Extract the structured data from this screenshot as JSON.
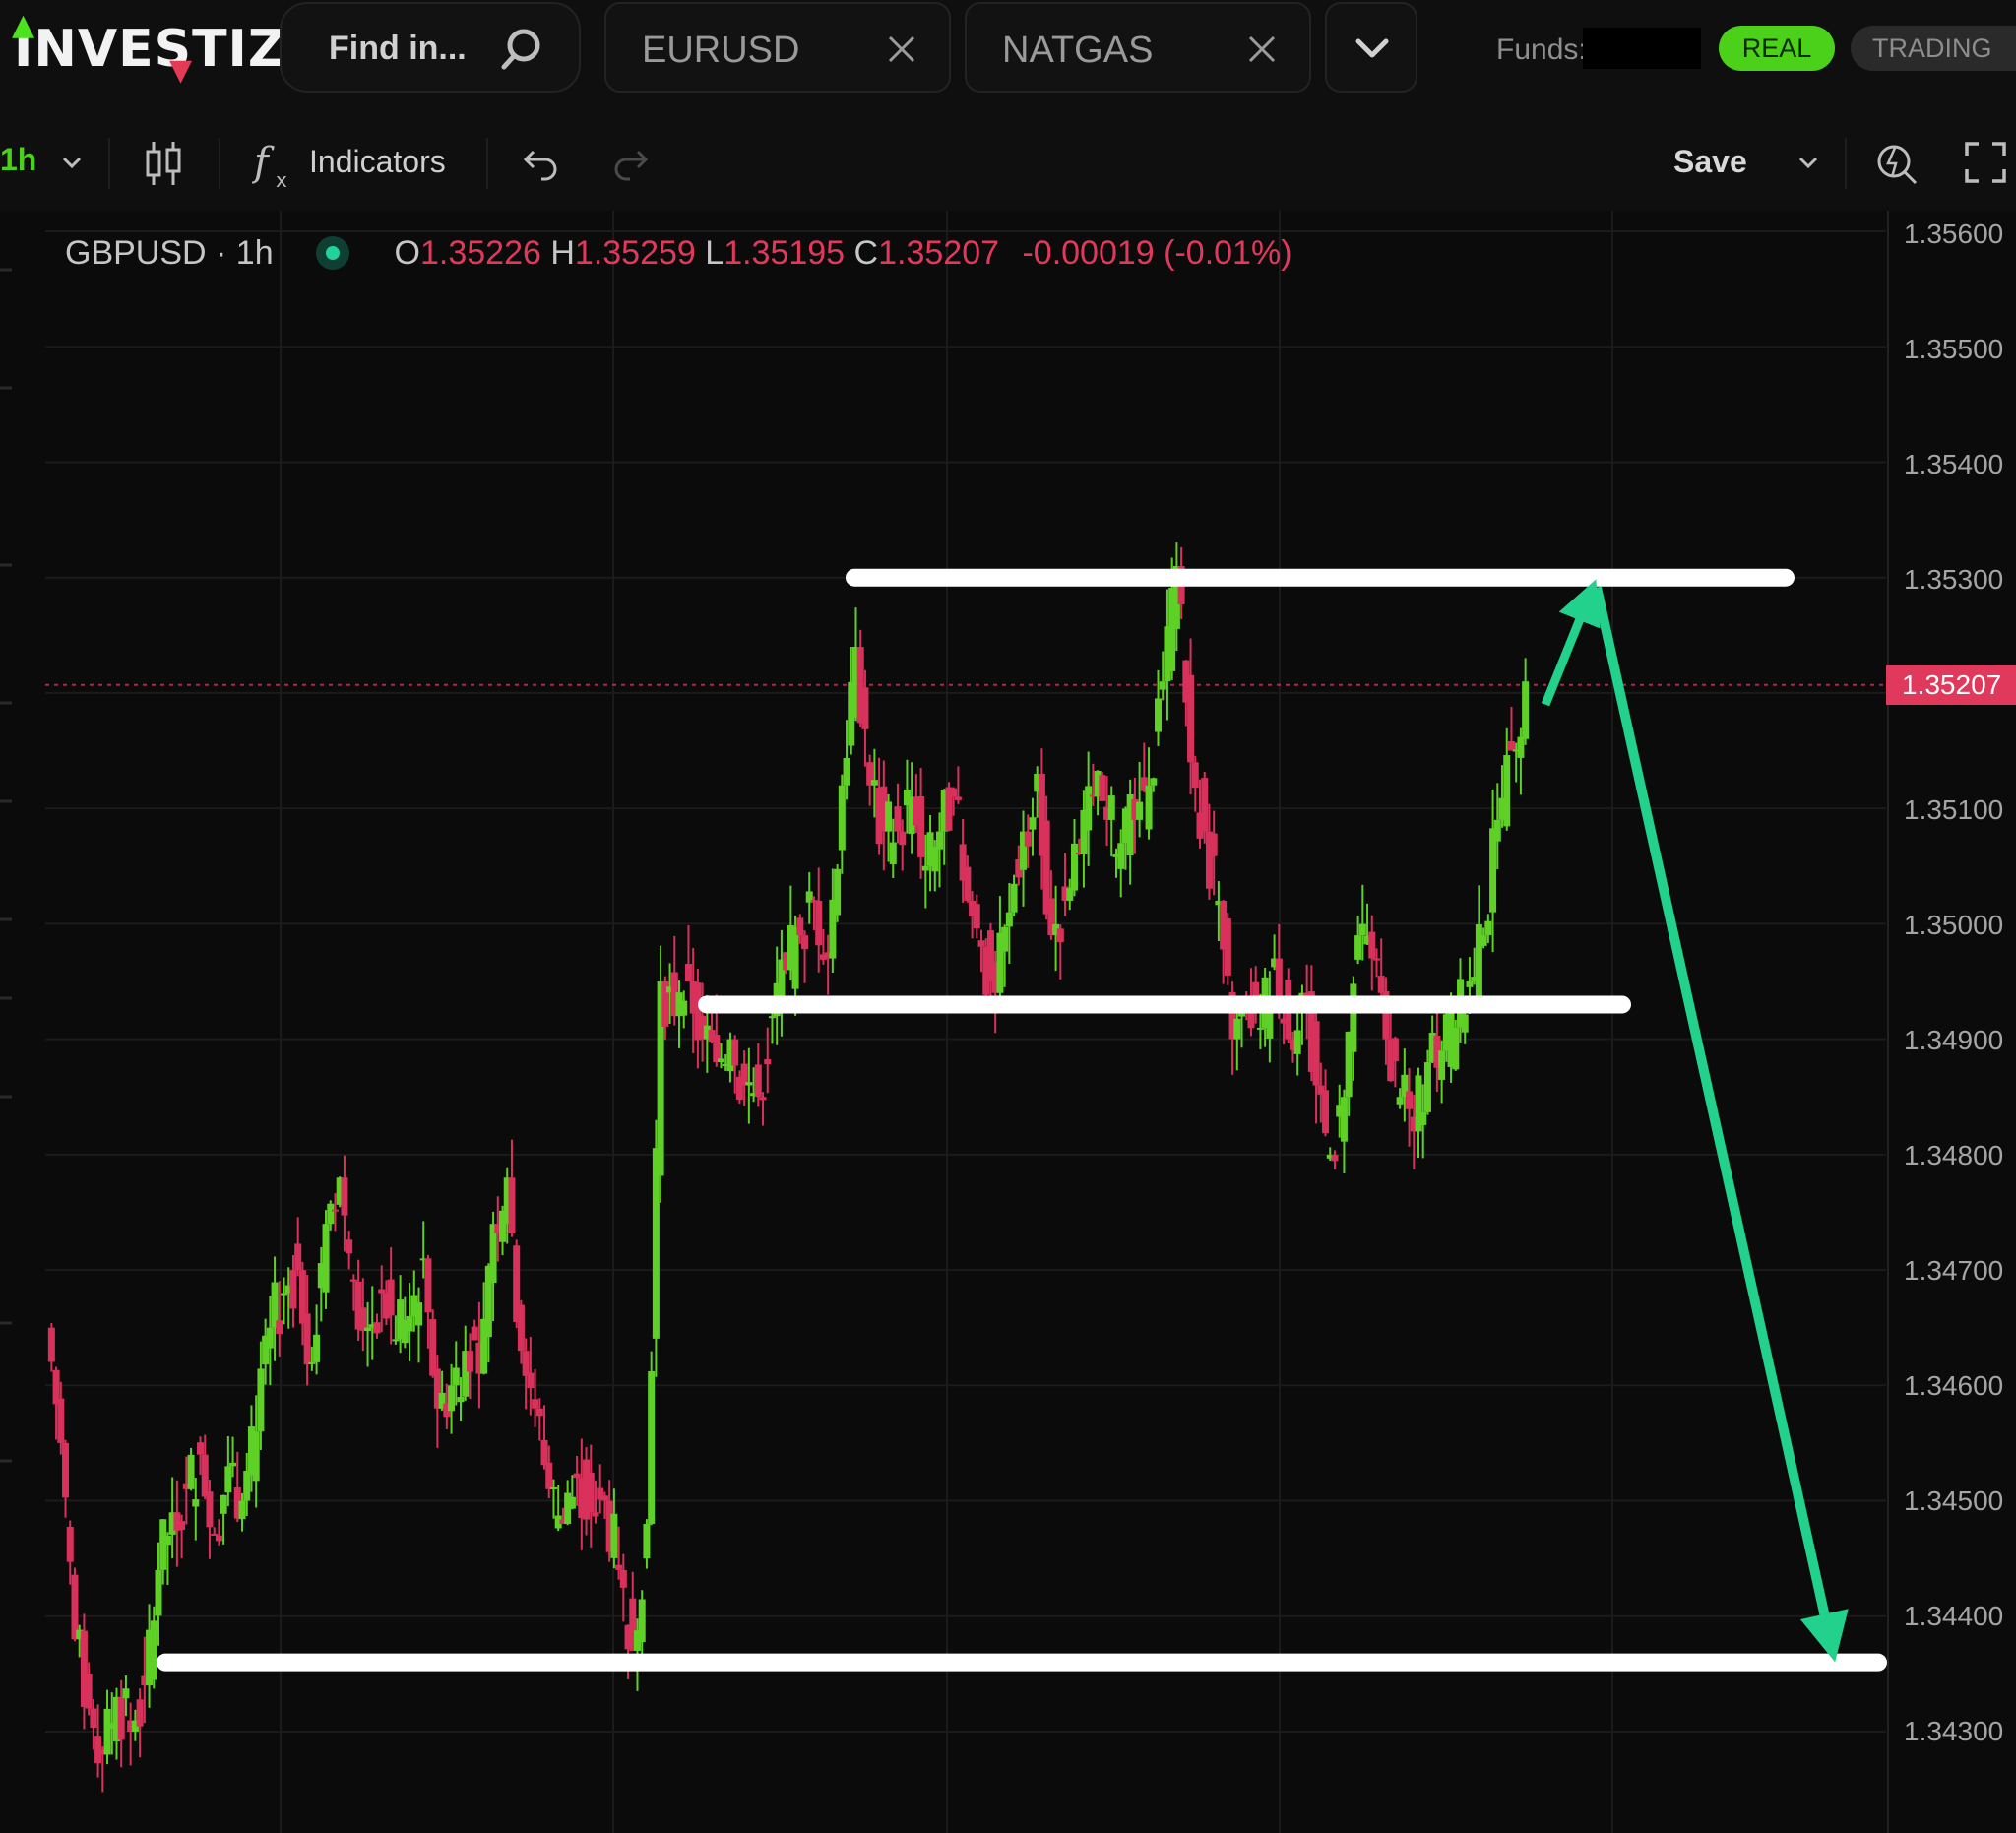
{
  "brand": {
    "name": "INVESTIZO"
  },
  "search": {
    "placeholder": "Find in..."
  },
  "tabs": [
    {
      "label": "EURUSD"
    },
    {
      "label": "NATGAS"
    }
  ],
  "account": {
    "funds_label": "Funds:",
    "real_label": "REAL",
    "trading_label": "TRADING"
  },
  "toolbar": {
    "interval": "1h",
    "indicators_label": "Indicators",
    "save_label": "Save"
  },
  "legend": {
    "symbol": "GBPUSD · 1h",
    "open_key": "O",
    "open": "1.35226",
    "high_key": "H",
    "high": "1.35259",
    "low_key": "L",
    "low": "1.35195",
    "close_key": "C",
    "close": "1.35207",
    "change": "-0.00019 (-0.01%)"
  },
  "price_axis": {
    "ticks": [
      "1.35600",
      "1.35500",
      "1.35400",
      "1.35300",
      "1.35207",
      "1.35100",
      "1.35000",
      "1.34900",
      "1.34800",
      "1.34700",
      "1.34600",
      "1.34500",
      "1.34400",
      "1.34300"
    ],
    "last_price": "1.35207"
  },
  "colors": {
    "bull": "#5fd126",
    "bear": "#d8315b",
    "arrow": "#22d18b",
    "annotation": "#ffffff"
  },
  "chart_data": {
    "type": "candlestick",
    "symbol": "GBPUSD",
    "interval": "1h",
    "ylim": [
      1.3425,
      1.3562
    ],
    "y_ticks": [
      1.356,
      1.355,
      1.354,
      1.353,
      1.351,
      1.35,
      1.349,
      1.348,
      1.347,
      1.346,
      1.345,
      1.344,
      1.343
    ],
    "last_price": 1.35207,
    "close_path": [
      1.3465,
      1.3455,
      1.3438,
      1.3432,
      1.3428,
      1.3433,
      1.343,
      1.3434,
      1.3444,
      1.3449,
      1.3451,
      1.3454,
      1.3447,
      1.3453,
      1.345,
      1.3456,
      1.3465,
      1.3468,
      1.347,
      1.3462,
      1.3474,
      1.3478,
      1.3469,
      1.3465,
      1.3468,
      1.3464,
      1.3466,
      1.3471,
      1.3458,
      1.346,
      1.3463,
      1.3461,
      1.3474,
      1.3478,
      1.3463,
      1.3458,
      1.3451,
      1.3448,
      1.3452,
      1.3449,
      1.345,
      1.3444,
      1.3437,
      1.3448,
      1.3495,
      1.3492,
      1.3495,
      1.349,
      1.3488,
      1.349,
      1.3486,
      1.3485,
      1.3492,
      1.3496,
      1.3499,
      1.3502,
      1.3497,
      1.3512,
      1.3524,
      1.3512,
      1.3508,
      1.3508,
      1.3511,
      1.3505,
      1.3508,
      1.3511,
      1.3502,
      1.3498,
      1.3494,
      1.3501,
      1.3508,
      1.3513,
      1.3499,
      1.3502,
      1.3506,
      1.3511,
      1.3509,
      1.3507,
      1.3509,
      1.3512,
      1.3521,
      1.3531,
      1.3514,
      1.3508,
      1.3502,
      1.349,
      1.3493,
      1.3491,
      1.3497,
      1.349,
      1.3494,
      1.3486,
      1.348,
      1.3485,
      1.3499,
      1.3497,
      1.349,
      1.3485,
      1.3482,
      1.3488,
      1.3489,
      1.3491,
      1.3495,
      1.3499,
      1.3509,
      1.3515,
      1.3521
    ],
    "annotations": {
      "resistance": 1.353,
      "mid_support": 1.3493,
      "support": 1.3436,
      "arrow_up_from": 1.3519,
      "arrow_up_to": 1.353,
      "arrow_down_from": 1.353,
      "arrow_down_to": 1.3436
    }
  }
}
